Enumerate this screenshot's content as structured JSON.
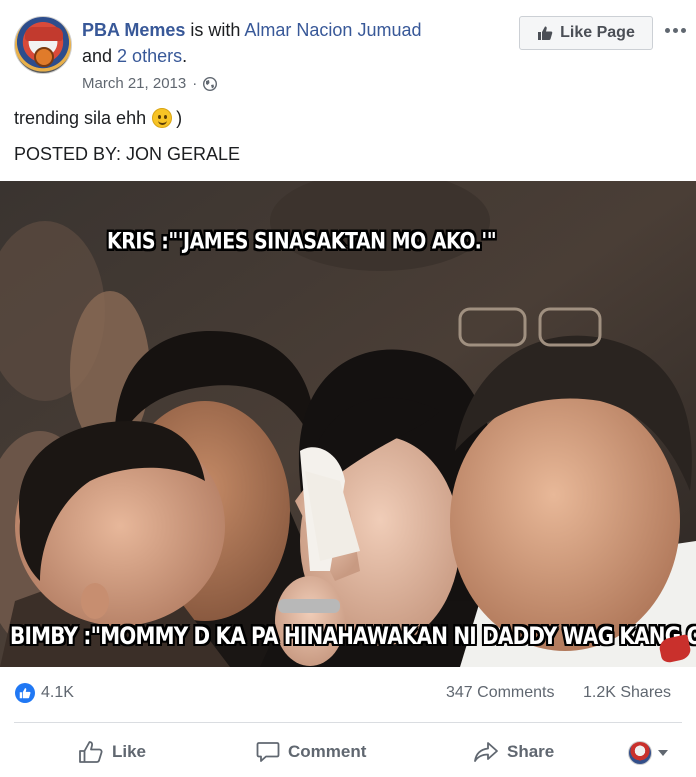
{
  "post": {
    "page_name": "PBA Memes",
    "is_with_text": " is with ",
    "tagged_person": "Almar Nacion Jumuad",
    "and_text": "and ",
    "others_link": "2 others",
    "period": ".",
    "date": "March 21, 2013",
    "date_separator": "·",
    "caption_line1_pre": "trending sila ehh",
    "caption_line1_post": ")",
    "caption_line2": "POSTED BY: JON GERALE",
    "like_page_label": "Like Page"
  },
  "photo": {
    "top_text": "KRIS :\"'JAMES SINASAKTAN MO AKO.'\"",
    "bottom_text": "BIMBY :\"MOMMY D KA PA HINAHAWAKAN NI DADDY WAG KANG OA\""
  },
  "stats": {
    "reactions": "4.1K",
    "comments": "347 Comments",
    "shares": "1.2K Shares"
  },
  "actions": {
    "like": "Like",
    "comment": "Comment",
    "share": "Share"
  },
  "colors": {
    "link": "#385898",
    "secondary_text": "#606770",
    "reaction_blue": "#2078f4"
  }
}
